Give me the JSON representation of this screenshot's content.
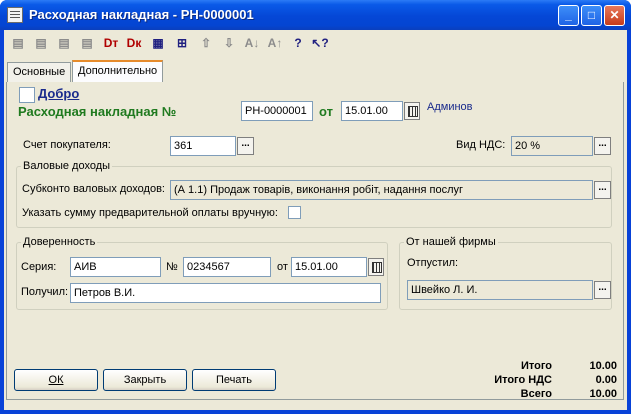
{
  "window": {
    "title": "Расходная накладная - РН-0000001",
    "minimize": "_",
    "maximize": "□",
    "close": "✕"
  },
  "toolbar": {
    "icons": [
      "new-doc-icon",
      "copy-doc-icon",
      "delete-doc-icon",
      "edit-doc-icon",
      "dt-icon",
      "dk-icon",
      "edit-row-icon",
      "delete-row-icon",
      "move-up-icon",
      "move-down-icon",
      "sort-asc-icon",
      "sort-desc-icon",
      "help-icon",
      "context-help-icon"
    ],
    "glyphs": [
      "▤",
      "▤",
      "▤",
      "▤",
      "Dт",
      "Dк",
      "▦",
      "⊞",
      "⇧",
      "⇩",
      "A↓",
      "A↑",
      "?",
      "↖?"
    ]
  },
  "tabs": [
    {
      "label": "Основные"
    },
    {
      "label": "Дополнительно"
    }
  ],
  "form": {
    "good_label": "Добро",
    "doc_heading": "Расходная накладная №",
    "doc_number": "РН-0000001",
    "from_label": "от",
    "doc_date": "15.01.00",
    "author": "Админов",
    "account_label": "Счет покупателя:",
    "account_value": "361",
    "vat_label": "Вид НДС:",
    "vat_value": "20 %",
    "gross_group": "Валовые доходы",
    "subconto_label": "Субконто валовых доходов:",
    "subconto_value": "(А 1.1) Продаж товарів, виконання робіт, надання послуг",
    "prepay_label": "Указать сумму предварительной оплаты вручную:",
    "proxy_group": "Доверенность",
    "series_label": "Серия:",
    "series_value": "АИВ",
    "num_label": "№",
    "num_value": "0234567",
    "proxy_from_label": "от",
    "proxy_date": "15.01.00",
    "received_label": "Получил:",
    "received_value": "Петров В.И.",
    "firm_group": "От нашей фирмы",
    "released_label": "Отпустил:",
    "released_value": "Швейко Л. И."
  },
  "buttons": {
    "ok": "ОК",
    "close": "Закрыть",
    "print": "Печать"
  },
  "totals": {
    "total_label": "Итого",
    "total_value": "10.00",
    "vat_label": "Итого НДС",
    "vat_value": "0.00",
    "all_label": "Всего",
    "all_value": "10.00"
  },
  "colors": {
    "title_bar": "#0547d6",
    "heading_green": "#1f7a1f",
    "link_blue": "#1a2b8c",
    "face": "#ece9d8"
  }
}
